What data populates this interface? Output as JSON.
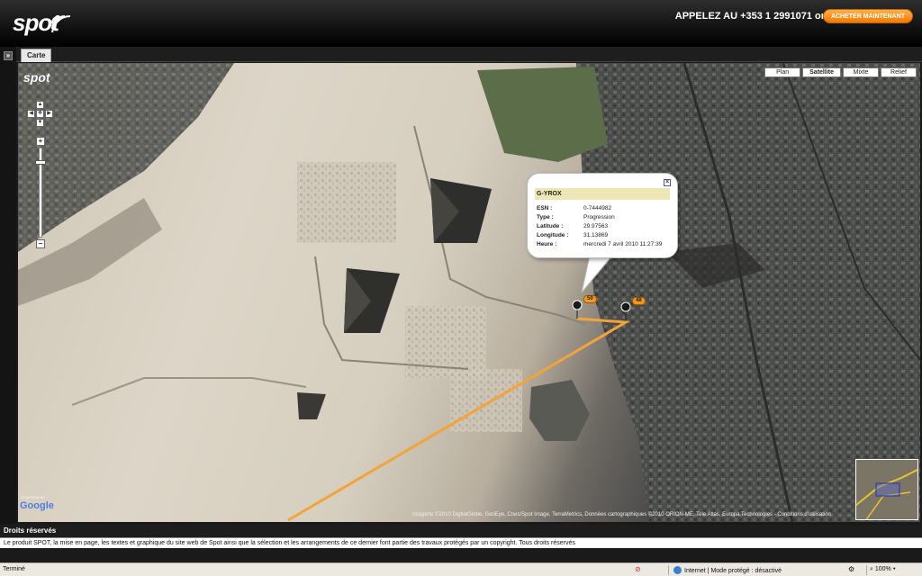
{
  "header": {
    "logo_text": "spot",
    "phone_text": "APPELEZ AU +353 1 2991071 or",
    "buy_button": "ACHETER MAINTENANT"
  },
  "tabs": [
    {
      "label": "Carte"
    }
  ],
  "map": {
    "logo_text": "spot",
    "types": [
      {
        "label": "Plan",
        "active": false
      },
      {
        "label": "Satellite",
        "active": true
      },
      {
        "label": "Mixte",
        "active": false
      },
      {
        "label": "Relief",
        "active": false
      }
    ],
    "zoom": {
      "in_label": "+",
      "out_label": "−"
    },
    "track_color": "#f2a43a",
    "markers": [
      {
        "label": "50"
      },
      {
        "label": "48"
      }
    ],
    "info_window": {
      "title": "G-YROX",
      "close": "×",
      "rows": [
        {
          "label": "ESN :",
          "value": "0-7444982"
        },
        {
          "label": "Type :",
          "value": "Progression"
        },
        {
          "label": "Latitude :",
          "value": "29.97563"
        },
        {
          "label": "Longitude :",
          "value": "31.13869"
        },
        {
          "label": "Heure :",
          "value": "mercredi 7 avril 2010 11:27:39"
        }
      ]
    },
    "attribution": "Imagerie ©2010 DigitalGlobe, GeoEye, Cnes/Spot Image, TerraMetrics, Données cartographiques ©2010 ORION-ME, Tele Atlas, Europa Technologies - Conditions d'utilisation",
    "google_powered": "POWERED BY",
    "google_logo": "Google"
  },
  "rights": {
    "title": "Droits réservés",
    "body": "Le produit SPOT, la mise en page, les textes et graphique du site web de Spot ainsi que la sélection et les arrangements de ce dernier font partie des travaux protégés par un copyright.  Tous droits réservés"
  },
  "statusbar": {
    "status": "Terminé",
    "zone": "Internet | Mode protégé : désactivé",
    "zoom": "100%"
  },
  "colors": {
    "accent_orange": "#f07a00",
    "info_header": "#ece7b4"
  }
}
